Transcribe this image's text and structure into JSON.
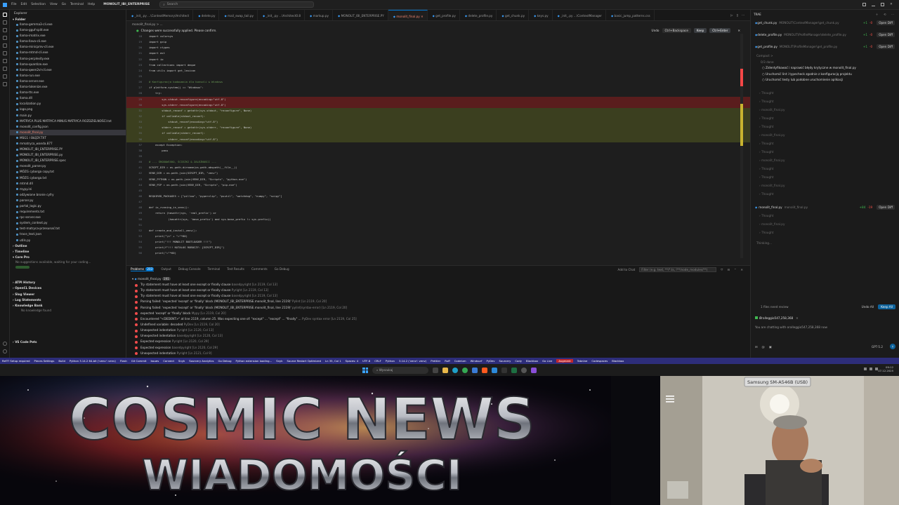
{
  "titlebar": {
    "menu": [
      "File",
      "Edit",
      "Selection",
      "View",
      "Go",
      "Terminal",
      "Help"
    ],
    "project": "MONOLIT_IBI_ENTERPRISE",
    "search_placeholder": "Search"
  },
  "explorer": {
    "header": "Explorer",
    "folder_section": "Folder",
    "files": [
      "llama-gemma3-cli.exe",
      "llama-gguf-split.exe",
      "llama-imatrix.exe",
      "llama-llava-cli.exe",
      "llama-minicpmv-cli.exe",
      "llama-mtmd-cli.exe",
      "llama-perplexity.exe",
      "llama-quantize.exe",
      "llama-qwen2vl-cli.exe",
      "llama-run.exe",
      "llama-server.exe",
      "llama-tokenize.exe",
      "llama-tts.exe",
      "llama.dll",
      "localization.py",
      "logo.png",
      "main.py",
      "MATRYCA PLUS MATRYCA MINUS MATRYCA ROZDZIELNOŚCI.txt",
      "monolit_config.json",
      "monolit_final.py",
      "MSG1 I BŁĘDY.TXT",
      "mmatryca_wanda.877",
      "MONOLIT_IBI_ENTERPRISE.PY",
      "MONOLIT_IBI_ENTERPRISE.py",
      "MONOLIT_IBI_ENTERPRISE.spec",
      "monolit_parser.py",
      "MÓZG cyborga copy.txt",
      "MÓZG cyborga.txt",
      "mtmd.dll",
      "mypy.ini",
      "odżywione bronie cyfry",
      "parser.py",
      "portal_logic.py",
      "requirements.txt",
      "rpc-server.exe",
      "system_context.py",
      "test-matryca-przesunać.txt",
      "trace_text.json",
      "utils.py"
    ],
    "active_index": 19,
    "outline": "Outline",
    "timeline": "Timeline",
    "copilot": "Core Pro",
    "copilot_note": "No suggestions available, waiting for your coding...",
    "sections": [
      "ATPI History",
      "OpenCL Devices",
      "Slog Viewer",
      "Log Statements",
      "Knowledge Bank"
    ],
    "kb_note": "No knowledge found",
    "vscode": "VS Code Pets"
  },
  "tabs": [
    {
      "label": "_init_.py ...\\ContextMemory\\Architect",
      "active": false
    },
    {
      "label": "delete.py",
      "active": false
    },
    {
      "label": "mail_swap_tail.py",
      "active": false
    },
    {
      "label": "_init_.py ...\\Architect0.8",
      "active": false
    },
    {
      "label": "markup.py",
      "active": false
    },
    {
      "label": "MONOLIT_IBI_ENTERPRISE.PY",
      "active": false
    },
    {
      "label": "monolit_final.py",
      "active": true
    },
    {
      "label": "get_profile.py",
      "active": false
    },
    {
      "label": "delete_profile.py",
      "active": false
    },
    {
      "label": "get_chunk.py",
      "active": false
    },
    {
      "label": "keys.py",
      "active": false
    },
    {
      "label": "_init_.py ...\\ContextManager",
      "active": false
    },
    {
      "label": "basic_jump_patterns.css",
      "active": false
    }
  ],
  "breadcrumb": "monolit_final.py > ...",
  "banner": {
    "text": "Changes were successfully applied. Please confirm.",
    "undo": "Undo",
    "undo_all": "Ctrl+Backspace",
    "keep": "Keep",
    "keep_all": "Ctrl+Enter"
  },
  "code": [
    {
      "n": "18",
      "t": "import colorsys",
      "k": ""
    },
    {
      "n": "19",
      "t": "import gzip",
      "k": ""
    },
    {
      "n": "20",
      "t": "import ctypes",
      "k": ""
    },
    {
      "n": "21",
      "t": "import ast",
      "k": ""
    },
    {
      "n": "22",
      "t": "import io",
      "k": ""
    },
    {
      "n": "23",
      "t": "from collections import deque",
      "k": ""
    },
    {
      "n": "24",
      "t": "from utils import get_lexicon",
      "k": ""
    },
    {
      "n": "25",
      "t": "",
      "k": ""
    },
    {
      "n": "26",
      "t": "# Konfiguracja kodowania dla konsoli w Windows",
      "k": "cm"
    },
    {
      "n": "27",
      "t": "if platform.system() == \"Windows\":",
      "k": ""
    },
    {
      "n": "28",
      "t": "    try:",
      "k": ""
    },
    {
      "n": "29",
      "t": "        sys.stdout.reconfigure(encoding=\"utf-8\")",
      "k": "del"
    },
    {
      "n": "30",
      "t": "        sys.stderr.reconfigure(encoding=\"utf-8\")",
      "k": "del"
    },
    {
      "n": "31",
      "t": "        stdout_reconf = getattr(sys.stdout, \"reconfigure\", None)",
      "k": "add"
    },
    {
      "n": "32",
      "t": "        if callable(stdout_reconf):",
      "k": "add"
    },
    {
      "n": "33",
      "t": "            stdout_reconf(encoding=\"utf-8\")",
      "k": "add"
    },
    {
      "n": "34",
      "t": "        stderr_reconf = getattr(sys.stderr, \"reconfigure\", None)",
      "k": "add"
    },
    {
      "n": "35",
      "t": "        if callable(stderr_reconf):",
      "k": "add"
    },
    {
      "n": "36",
      "t": "            stderr_reconf(encoding=\"utf-8\")",
      "k": "add"
    },
    {
      "n": "37",
      "t": "    except Exception:",
      "k": ""
    },
    {
      "n": "38",
      "t": "        pass",
      "k": ""
    },
    {
      "n": "39",
      "t": "",
      "k": ""
    },
    {
      "n": "40",
      "t": "# --- ŚRODOWISKO, ŚCIEŻKI & ZALEŻNOŚCI ---",
      "k": "cm"
    },
    {
      "n": "41",
      "t": "SCRIPT_DIR = os.path.dirname(os.path.abspath(__file__))",
      "k": ""
    },
    {
      "n": "42",
      "t": "VENV_DIR = os.path.join(SCRIPT_DIR, \"venv\")",
      "k": ""
    },
    {
      "n": "43",
      "t": "VENV_PYTHON = os.path.join(VENV_DIR, \"Scripts\", \"python.exe\")",
      "k": ""
    },
    {
      "n": "44",
      "t": "VENV_PIP = os.path.join(VENV_DIR, \"Scripts\", \"pip.exe\")",
      "k": ""
    },
    {
      "n": "45",
      "t": "",
      "k": ""
    },
    {
      "n": "46",
      "t": "REQUIRED_PACKAGES = [\"pillow\", \"pyperclip\", \"psutil\", \"watchdog\", \"numpy\", \"scipy\"]",
      "k": ""
    },
    {
      "n": "47",
      "t": "",
      "k": ""
    },
    {
      "n": "48",
      "t": "def is_running_in_venv():",
      "k": ""
    },
    {
      "n": "49",
      "t": "    return (hasattr(sys, 'real_prefix') or",
      "k": ""
    },
    {
      "n": "50",
      "t": "            (hasattr(sys, 'base_prefix') and sys.base_prefix != sys.prefix))",
      "k": ""
    },
    {
      "n": "51",
      "t": "",
      "k": ""
    },
    {
      "n": "52",
      "t": "def create_and_install_venv():",
      "k": ""
    },
    {
      "n": "53",
      "t": "    print(\"\\n\" + \"=\"*60)",
      "k": ""
    },
    {
      "n": "54",
      "t": "    print(\"!!! MONOLIT BOOTLOADER !!!\")",
      "k": ""
    },
    {
      "n": "55",
      "t": "    print(f\"!!! KATALOG ROBOCZY: {SCRIPT_DIR}\")",
      "k": ""
    },
    {
      "n": "56",
      "t": "    print(\"=\"*60)",
      "k": ""
    }
  ],
  "panel": {
    "tabs": [
      "Problems",
      "Output",
      "Debug Console",
      "Terminal",
      "Test Results",
      "Comments",
      "Go Debug"
    ],
    "problems_count": "203",
    "add_to_chat": "Add to Chat",
    "filter_placeholder": "Filter (e.g. text, **/*.ts, !**/node_modules/**)",
    "file": "monolit_final.py",
    "file_count": "191",
    "rows": [
      {
        "msg": "Try statement must have at least one except or finally clause",
        "src": "basedpyright  [Ln 2119, Col 13]"
      },
      {
        "msg": "Try statement must have at least one except or finally clause",
        "src": "Pyright  [Ln 2119, Col 13]"
      },
      {
        "msg": "Try statement must have at least one except or finally clause",
        "src": "basedpyright  [Ln 2119, Col 13]"
      },
      {
        "msg": "Parsing failed: 'expected 'except' or 'finally' block (MONOLIT_IBI_ENTERPRISE.monolit_final, line 2119)'",
        "src": "Pylint  [Ln 2119, Col 20]"
      },
      {
        "msg": "Parsing failed: 'expected 'except' or 'finally' block (MONOLIT_IBI_ENTERPRISE.monolit_final, line 2119)'",
        "src": "pylint(syntax-error)  [Ln 2119, Col 20]"
      },
      {
        "msg": "expected 'except' or 'finally' block",
        "src": "Mypy  [Ln 2119, Col 20]"
      },
      {
        "msg": "Encountered \"<DEDENT>\" at line 2119, column 25. Was expecting one of:   \"except\" ...   \"except\" ...   \"finally\" ...",
        "src": "PyDev syntax error  [Ln 2119, Col 25]"
      },
      {
        "msg": "Undefined variable: decoded",
        "src": "PyDev  [Ln 2119, Col 20]"
      },
      {
        "msg": "Unexpected indentation",
        "src": "Pyright  [Ln 2120, Col 13]"
      },
      {
        "msg": "Unexpected indentation",
        "src": "basedpyright  [Ln 2120, Col 13]"
      },
      {
        "msg": "Expected expression",
        "src": "Pyright  [Ln 2120, Col 29]"
      },
      {
        "msg": "Expected expression",
        "src": "basedpyright  [Ln 2120, Col 29]"
      },
      {
        "msg": "Unexpected indentation",
        "src": "Pyright  [Ln 2121, Col 9]"
      }
    ]
  },
  "chat": {
    "title": "TRAE",
    "files": [
      {
        "name": "get_chunk.py",
        "path": "MONOLIT\\ContextManager\\get_chunk.py",
        "plus": "+1",
        "minus": "-0",
        "open": "Open Diff"
      },
      {
        "name": "delete_profile.py",
        "path": "MONOLIT\\ProfileManager\\delete_profile.py",
        "plus": "+1",
        "minus": "-0",
        "open": "Open Diff"
      },
      {
        "name": "get_profile.py",
        "path": "MONOLIT\\ProfileManager\\get_profile.py",
        "plus": "+1",
        "minus": "-0",
        "open": "Open Diff"
      }
    ],
    "compact": "Compact >",
    "todo_header": "0/3 done",
    "todos": [
      "Zidentyfikować i naprawić błędy krytyczne w monolit_final.py",
      "Uruchomić lint i typecheck zgodnie z konfiguracją projektu",
      "Uruchomić testy lub podobne uruchomienie aplikacji"
    ],
    "thoughts": [
      "Thought",
      "Thought",
      "monolit_final.py",
      "Thought",
      "Thought",
      "monolit_final.py",
      "Thought",
      "Thought",
      "monolit_final.py",
      "Thought",
      "Thought",
      "monolit_final.py",
      "Thought",
      "Thought",
      "monolit_final.py",
      "Thought"
    ],
    "changed_file": {
      "name": "monolit_final.py",
      "path": "monolit_final.py",
      "plus": "+84",
      "minus": "-19",
      "open": "Open Diff"
    },
    "thinking": "Thinking...",
    "files_need_review": "1 files need review",
    "undo_all": "Undo All",
    "keep_all": "Keep All",
    "user": "Øralleggio547,258,368",
    "chatting_note": "You are chatting with oralleggio547,258,368 now",
    "model": "GPT-5.2"
  },
  "statusbar": [
    "Ref??  Setup required",
    "Pieces Settings",
    "Build",
    "Python 3.14.2 64-bit ('venv': venv)",
    "Flash",
    "Git Commit",
    "Issues",
    "Connect",
    "Snyk",
    "Sourcery Analytics",
    "Go Debug",
    "Python extension loading...",
    "Snyk",
    "Source Restart Optimized",
    "Ln 35, Col 1",
    "Spaces: 4",
    "UTF-8",
    "CRLF",
    "Python",
    "3.14.2 ('venv': venv)",
    "Prettier",
    "Ruff",
    "Codeium",
    "Windsurf",
    "PyDev",
    "Sourcery",
    "Cody",
    "Blackbox",
    "Go Live",
    "Augment",
    "Tabnine",
    "Codespaces",
    "Blackbox"
  ],
  "statusbar_red": "Augment",
  "taskbar": {
    "search": "Wyszukaj",
    "time": "09:12",
    "date": "07.12.2025"
  },
  "banner_video": {
    "title": "COSMIC NEWS",
    "subtitle": "WIADOMOŚCI"
  },
  "webcam": {
    "device_label": "Samsung SM-A546B (USB)"
  },
  "colors": {
    "accent": "#0078d4",
    "statusbar": "#2d2d7a",
    "error": "#f14c4c",
    "active_file": "#f48771"
  }
}
